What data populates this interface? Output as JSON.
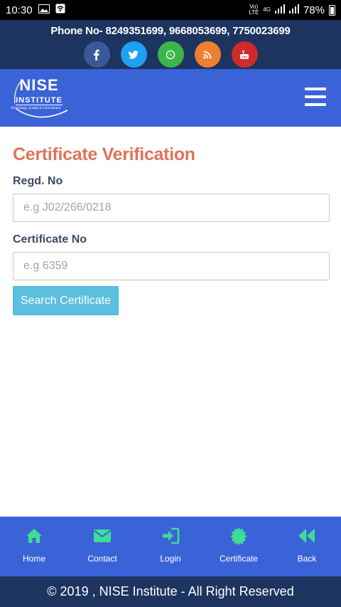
{
  "status_bar": {
    "time": "10:30",
    "volte": "Vo)",
    "lte": "LTE",
    "network": "4G",
    "battery": "78%"
  },
  "header": {
    "phone": "Phone No- 8249351699, 9668053699, 7750023699",
    "social": [
      {
        "name": "facebook-icon",
        "color": "#3b5998"
      },
      {
        "name": "twitter-icon",
        "color": "#1da1f2"
      },
      {
        "name": "whatsapp-icon",
        "color": "#3cb54a"
      },
      {
        "name": "rss-icon",
        "color": "#f07e2f"
      },
      {
        "name": "youtube-icon",
        "color": "#d02a2a"
      }
    ]
  },
  "logo": {
    "title": "NISE",
    "subtitle": "INSTITUTE",
    "tagline": "Technology, Quality & Commitment"
  },
  "form": {
    "title": "Certificate Verification",
    "regd_label": "Regd. No",
    "regd_placeholder": "e.g J02/266/0218",
    "regd_value": "",
    "cert_label": "Certificate No",
    "cert_placeholder": "e.g 6359",
    "cert_value": "",
    "search_label": "Search Certificate"
  },
  "bottom_nav": {
    "items": [
      {
        "label": "Home",
        "icon": "home-icon"
      },
      {
        "label": "Contact",
        "icon": "envelope-icon"
      },
      {
        "label": "Login",
        "icon": "sign-in-icon"
      },
      {
        "label": "Certificate",
        "icon": "certificate-icon"
      },
      {
        "label": "Back",
        "icon": "back-icon"
      }
    ],
    "icon_color": "#3ddc97"
  },
  "footer": {
    "text": "© 2019 , NISE Institute - All Right Reserved"
  },
  "colors": {
    "header_bg": "#1d3460",
    "nav_bg": "#3b63d8",
    "title_color": "#e0735a",
    "button_bg": "#5bc0de"
  }
}
